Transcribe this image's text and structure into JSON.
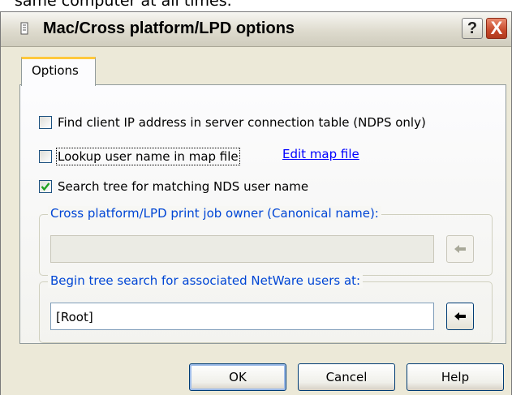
{
  "background_caption": "same computer at all times.",
  "dialog": {
    "title": "Mac/Cross platform/LPD options",
    "help_glyph": "?",
    "close_glyph": "X",
    "title_icon": "printer-config-icon",
    "close_color": "#c74a2b"
  },
  "tabs": [
    {
      "label": "Options",
      "active": true
    }
  ],
  "options": {
    "checkboxes": [
      {
        "label": "Find client IP address in server connection table (NDPS only)",
        "checked": false
      },
      {
        "label": "Lookup user name in map file",
        "checked": false
      },
      {
        "label": "Search tree for matching NDS user name",
        "checked": true
      }
    ],
    "edit_map_link": "Edit map file",
    "job_owner_group": {
      "label": "Cross platform/LPD print job owner (Canonical name):",
      "value": "",
      "enabled": false,
      "button_icon": "arrow-left-icon"
    },
    "tree_search_group": {
      "label": "Begin tree search for associated NetWare users at:",
      "value": "[Root]",
      "enabled": true,
      "button_icon": "arrow-left-icon"
    }
  },
  "buttons": {
    "ok": "OK",
    "cancel": "Cancel",
    "help": "Help"
  },
  "colors": {
    "link": "#0000ff",
    "group_label": "#0046d5",
    "tab_highlight": "#ffc83c",
    "checkmark": "#21a121"
  }
}
